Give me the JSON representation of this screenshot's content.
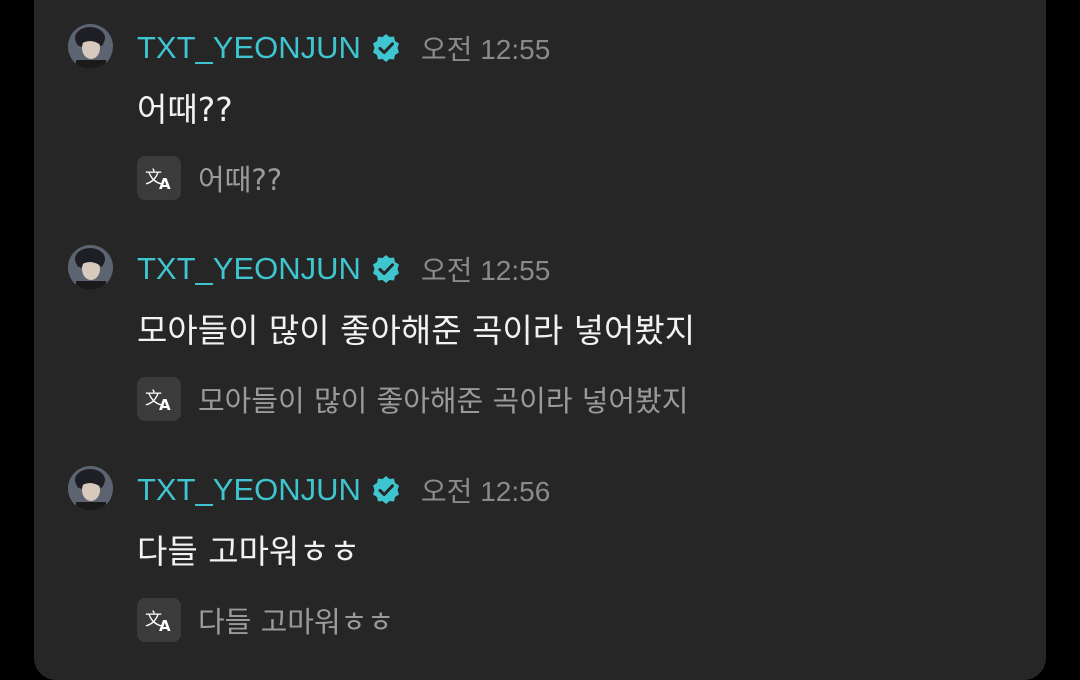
{
  "theme": {
    "background": "#262626",
    "username_color": "#3ec5cf",
    "verified_color": "#3ec5cf",
    "time_color": "#8a8a8a",
    "text_color": "#f2f2f2",
    "translation_color": "#9a9a9a"
  },
  "messages": [
    {
      "username": "TXT_YEONJUN",
      "verified_icon": "verified-badge-icon",
      "time": "오전 12:55",
      "text": "어때??",
      "translate_icon": "translate-icon",
      "translation": "어때??"
    },
    {
      "username": "TXT_YEONJUN",
      "verified_icon": "verified-badge-icon",
      "time": "오전 12:55",
      "text": "모아들이 많이 좋아해준 곡이라 넣어봤지",
      "translate_icon": "translate-icon",
      "translation": "모아들이 많이 좋아해준 곡이라 넣어봤지"
    },
    {
      "username": "TXT_YEONJUN",
      "verified_icon": "verified-badge-icon",
      "time": "오전 12:56",
      "text": "다들 고마워ㅎㅎ",
      "translate_icon": "translate-icon",
      "translation": "다들 고마워ㅎㅎ"
    }
  ]
}
